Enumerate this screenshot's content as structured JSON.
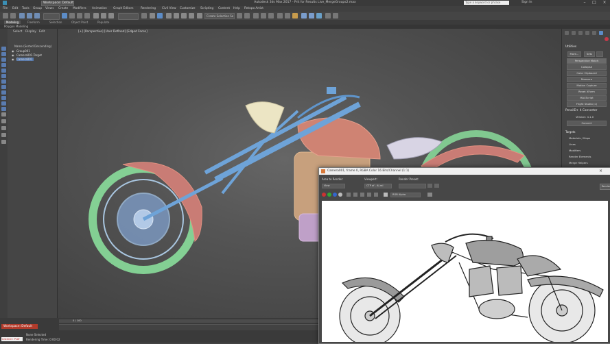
{
  "titlebar": {
    "workspace": "Workspace: Default",
    "title": "Autodesk 3ds Max 2017 - Prit for Results   Live_MergeGroups2.max",
    "search_placeholder": "Type a keyword or phrase",
    "user": "Sign In"
  },
  "menu": [
    "File",
    "Edit",
    "Tools",
    "Group",
    "Views",
    "Create",
    "Modifiers",
    "Animation",
    "Graph Editors",
    "Rendering",
    "Civil View",
    "Customize",
    "Scripting",
    "Content",
    "Help",
    "Retopo Artist"
  ],
  "toolbar": {
    "selection_set": "Create Selection Se"
  },
  "ribbon": {
    "tabs": [
      "Modeling",
      "Freeform",
      "Selection",
      "Object Paint",
      "Populate"
    ],
    "sub": "Polygon Modeling"
  },
  "scene_explorer": {
    "tabs": [
      "Select",
      "Display",
      "Edit"
    ],
    "header": "Name (Sorted Descending)",
    "rows": [
      "Group001",
      "Camera001.Target",
      "Camera001"
    ]
  },
  "viewport": {
    "label": "[+] [Perspective] [User Defined] [Edged Faces]"
  },
  "command_panel": {
    "utilities": "Utilities",
    "more": "More...",
    "sets": "Sets",
    "buttons": [
      "Perspective Match",
      "Collapse",
      "Color Clipboard",
      "Measure",
      "Motion Capture",
      "Reset XForm",
      "MAXScript",
      "Flight Studio (c)"
    ],
    "converter_title": "PencilD+ 4 Converter",
    "version": "Version: 4.1.0",
    "convert": "Convert",
    "targets_title": "Targets",
    "targets": [
      "Materials / Maps",
      "Lines",
      "Modifiers",
      "Render Elements",
      "Merge Helpers"
    ]
  },
  "render_window": {
    "title": "Camera001, frame 0, RGBA Color 16 Bits/Channel (1:1)",
    "area_label": "Area to Render:",
    "area_value": "View",
    "viewport_label": "Viewport:",
    "viewport_value": "CTP of - Al-ral",
    "preset_label": "Render Preset:",
    "channel": "RGB Alpha",
    "render_btn": "Render"
  },
  "timeline": {
    "frame": "0 / 100",
    "status_selected": "None Selected",
    "status_time": "Rendering Time: 0:00:02",
    "workspace": "Workspace: Default",
    "listener": "Listener: PLW"
  },
  "colors": {
    "workspace_red": "#b13b2b",
    "wire_blue": "#6ea3d8",
    "wire_red": "#d8796a",
    "wire_green": "#8de6a0"
  }
}
